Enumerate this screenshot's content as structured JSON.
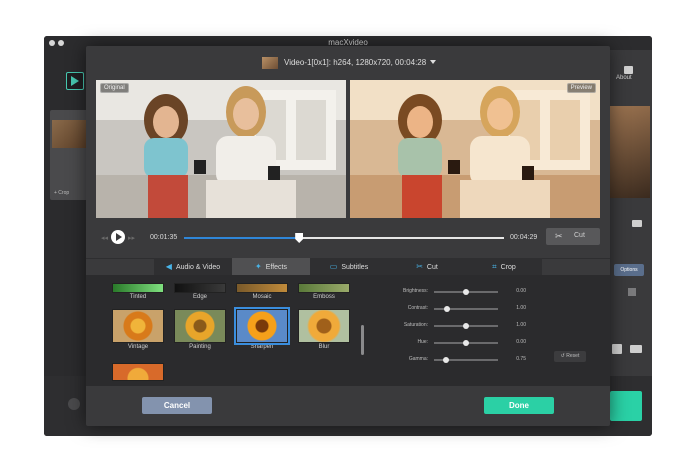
{
  "window": {
    "title": "macXvideo"
  },
  "background": {
    "about_label": "About",
    "crop_label": "+ Crop",
    "options_label": "Options"
  },
  "editor": {
    "video_info": "Video-1[0x1]: h264, 1280x720, 00:04:28",
    "original_label": "Original",
    "preview_label": "Preview",
    "timeline": {
      "current_time": "00:01:35",
      "end_time": "00:04:29",
      "progress": 0.36
    },
    "cut_button": "Cut",
    "tabs": [
      {
        "label": "Audio & Video",
        "icon": "speaker-icon"
      },
      {
        "label": "Effects",
        "icon": "magic-wand-icon",
        "active": true
      },
      {
        "label": "Subtitles",
        "icon": "subtitles-icon"
      },
      {
        "label": "Cut",
        "icon": "scissors-icon"
      },
      {
        "label": "Crop",
        "icon": "crop-icon"
      }
    ],
    "effects": [
      {
        "label": "Tinted"
      },
      {
        "label": "Edge"
      },
      {
        "label": "Mosaic"
      },
      {
        "label": "Emboss"
      },
      {
        "label": "Vintage"
      },
      {
        "label": "Painting"
      },
      {
        "label": "Sharpen",
        "selected": true
      },
      {
        "label": "Blur"
      }
    ],
    "adjustments": [
      {
        "label": "Brightness:",
        "value": "0.00",
        "level": 0.5
      },
      {
        "label": "Contrast:",
        "value": "1.00",
        "level": 0.2
      },
      {
        "label": "Saturation:",
        "value": "1.00",
        "level": 0.5
      },
      {
        "label": "Hue:",
        "value": "0.00",
        "level": 0.5
      },
      {
        "label": "Gamma:",
        "value": "0.75",
        "level": 0.18
      }
    ],
    "reset_button": "Reset",
    "cancel_button": "Cancel",
    "done_button": "Done"
  },
  "colors": {
    "accent_blue": "#2f86d8",
    "done_green": "#2bd0a5",
    "cancel_blue": "#8393ae"
  }
}
